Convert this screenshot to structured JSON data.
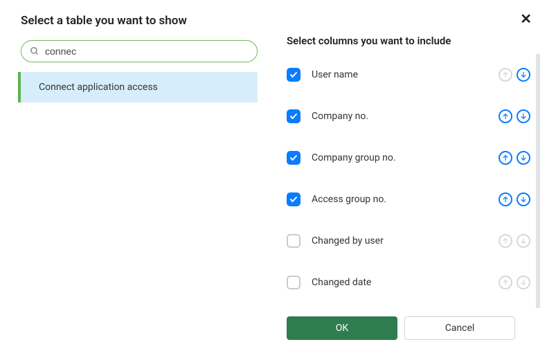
{
  "left": {
    "title": "Select a table you want to show",
    "search_value": "connec",
    "items": [
      {
        "label": "Connect application access",
        "selected": true
      }
    ]
  },
  "right": {
    "title": "Select columns you want to include"
  },
  "columns": [
    {
      "label": "User name",
      "checked": true,
      "up_enabled": false,
      "down_enabled": true
    },
    {
      "label": "Company no.",
      "checked": true,
      "up_enabled": true,
      "down_enabled": true
    },
    {
      "label": "Company group no.",
      "checked": true,
      "up_enabled": true,
      "down_enabled": true
    },
    {
      "label": "Access group no.",
      "checked": true,
      "up_enabled": true,
      "down_enabled": true
    },
    {
      "label": "Changed by user",
      "checked": false,
      "up_enabled": false,
      "down_enabled": false
    },
    {
      "label": "Changed date",
      "checked": false,
      "up_enabled": false,
      "down_enabled": false
    }
  ],
  "footer": {
    "ok": "OK",
    "cancel": "Cancel"
  }
}
